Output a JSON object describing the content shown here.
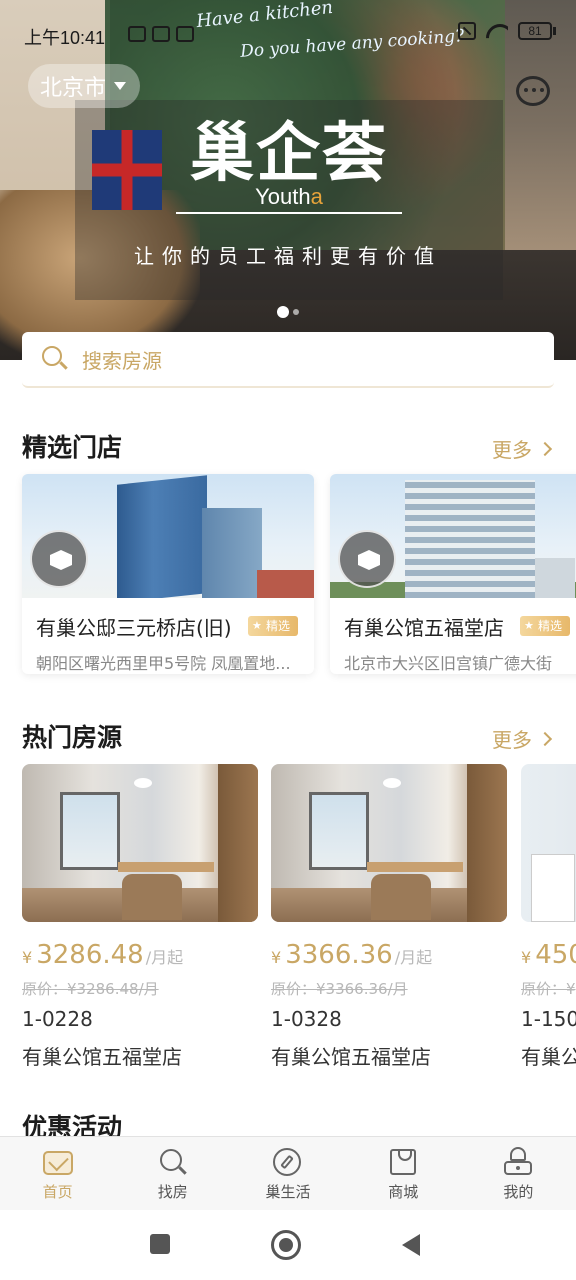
{
  "status_bar": {
    "time": "上午10:41",
    "battery": "81"
  },
  "header": {
    "city": "北京市"
  },
  "banner": {
    "brand_cn": "巢企荟",
    "brand_en_prefix": "Youth",
    "brand_en_suffix": "a",
    "slogan": "让你的员工福利更有价值",
    "mural_text_1": "Have a kitchen",
    "mural_text_2": "Do you have any cooking?",
    "active_slide": 1,
    "slide_count": 2
  },
  "search": {
    "placeholder": "搜索房源"
  },
  "featured_stores": {
    "title": "精选门店",
    "more_label": "更多",
    "items": [
      {
        "name": "有巢公邸三元桥店(旧)",
        "badge": "精选",
        "address": "朝阳区曙光西里甲5号院 凤凰置地..."
      },
      {
        "name": "有巢公馆五福堂店",
        "badge": "精选",
        "address": "北京市大兴区旧宫镇广德大街"
      }
    ]
  },
  "hot_rooms": {
    "title": "热门房源",
    "more_label": "更多",
    "currency": "¥",
    "unit": "/月起",
    "items": [
      {
        "price": "3286.48",
        "original": "原价：¥3286.48/月",
        "room": "1-0228",
        "store": "有巢公馆五福堂店"
      },
      {
        "price": "3366.36",
        "original": "原价：¥3366.36/月",
        "room": "1-0328",
        "store": "有巢公馆五福堂店"
      },
      {
        "price": "450",
        "original": "原价：¥",
        "room": "1-150",
        "store": "有巢公"
      }
    ]
  },
  "promotions": {
    "title": "优惠活动"
  },
  "tabs": [
    {
      "label": "首页",
      "icon": "home-icon",
      "active": true
    },
    {
      "label": "找房",
      "icon": "search-icon",
      "active": false
    },
    {
      "label": "巢生活",
      "icon": "compass-icon",
      "active": false
    },
    {
      "label": "商城",
      "icon": "shopping-bag-icon",
      "active": false
    },
    {
      "label": "我的",
      "icon": "user-icon",
      "active": false
    }
  ],
  "colors": {
    "accent": "#c9a765",
    "brand_orange": "#e7a33a"
  }
}
